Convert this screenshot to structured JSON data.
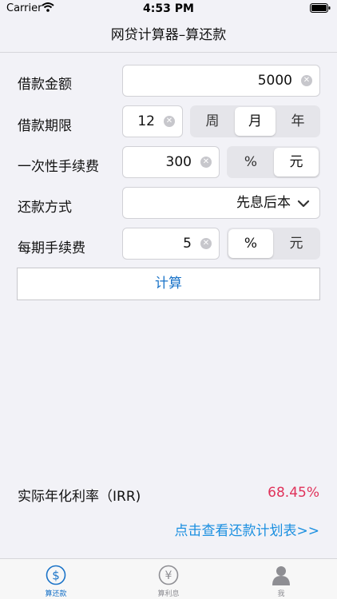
{
  "status_bar": {
    "carrier": "Carrier",
    "time": "4:53 PM"
  },
  "nav": {
    "title": "网贷计算器–算还款"
  },
  "form": {
    "loan_amount": {
      "label": "借款金额",
      "value": "5000"
    },
    "loan_term": {
      "label": "借款期限",
      "value": "12",
      "units": [
        "周",
        "月",
        "年"
      ],
      "selected_unit": "月"
    },
    "one_time_fee": {
      "label": "一次性手续费",
      "value": "300",
      "units": [
        "%",
        "元"
      ],
      "selected_unit": "元"
    },
    "repayment_method": {
      "label": "还款方式",
      "value": "先息后本"
    },
    "periodic_fee": {
      "label": "每期手续费",
      "value": "5",
      "units": [
        "%",
        "元"
      ],
      "selected_unit": "%"
    }
  },
  "calculate_label": "计算",
  "result": {
    "irr_label": "实际年化利率（IRR)",
    "irr_value": "68.45%"
  },
  "plan_link": "点击查看还款计划表>>",
  "tabs": [
    {
      "label": "算还款",
      "icon": "dollar-circle-icon",
      "active": true
    },
    {
      "label": "算利息",
      "icon": "yen-circle-icon",
      "active": false
    },
    {
      "label": "我",
      "icon": "person-icon",
      "active": false
    }
  ],
  "colors": {
    "accent": "#1a73c8",
    "irr": "#e0325a",
    "link": "#1a8fe0"
  }
}
